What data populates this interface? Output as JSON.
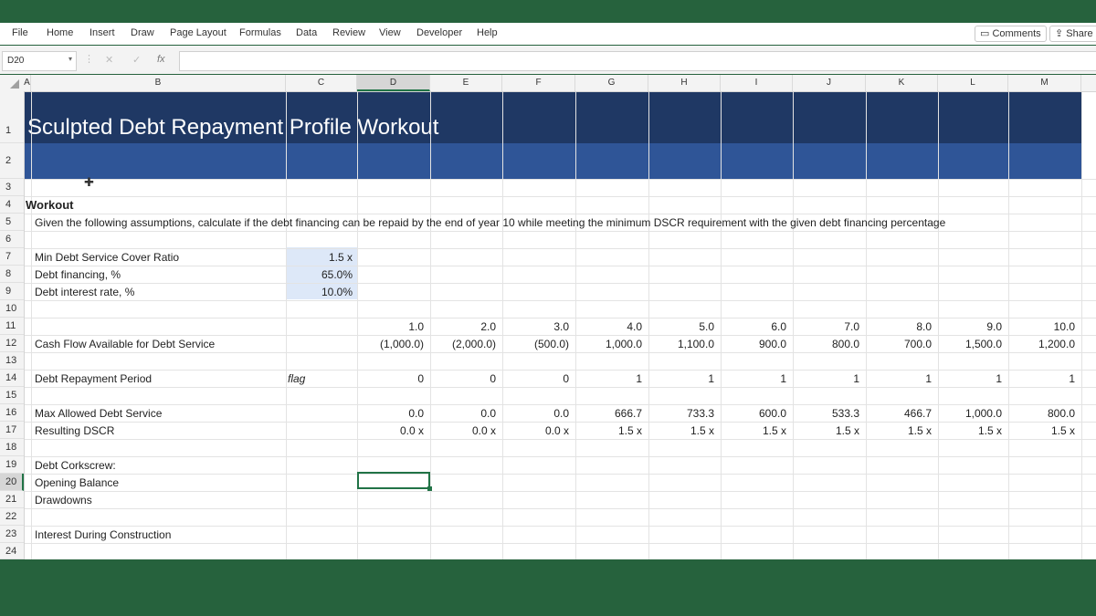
{
  "menu": {
    "items": [
      "File",
      "Home",
      "Insert",
      "Draw",
      "Page Layout",
      "Formulas",
      "Data",
      "Review",
      "View",
      "Developer",
      "Help"
    ],
    "comments": "Comments",
    "share": "Share"
  },
  "formula_bar": {
    "name_box": "D20",
    "fx": "fx",
    "formula": ""
  },
  "columns": [
    "A",
    "B",
    "C",
    "D",
    "E",
    "F",
    "G",
    "H",
    "I",
    "J",
    "K",
    "L",
    "M"
  ],
  "selected_column": "D",
  "rows": [
    "1",
    "2",
    "3",
    "4",
    "5",
    "6",
    "7",
    "8",
    "9",
    "10",
    "11",
    "12",
    "13",
    "14",
    "15",
    "16",
    "17",
    "18",
    "19",
    "20",
    "21",
    "22",
    "23",
    "24"
  ],
  "selected_row": "20",
  "sheet": {
    "title": "Sculpted Debt Repayment Profile Workout",
    "section": "Workout",
    "instructions": "Given the following assumptions, calculate if the debt financing can be repaid by the end of year 10 while meeting the minimum DSCR requirement with the given debt financing percentage",
    "assumptions": [
      {
        "label": "Min Debt Service Cover Ratio",
        "value": "1.5 x"
      },
      {
        "label": "Debt financing, %",
        "value": "65.0%"
      },
      {
        "label": "Debt interest rate, %",
        "value": "10.0%"
      }
    ],
    "years": [
      "1.0",
      "2.0",
      "3.0",
      "4.0",
      "5.0",
      "6.0",
      "7.0",
      "8.0",
      "9.0",
      "10.0"
    ],
    "cfads": {
      "label": "Cash Flow Available for Debt Service",
      "values": [
        "(1,000.0)",
        "(2,000.0)",
        "(500.0)",
        "1,000.0",
        "1,100.0",
        "900.0",
        "800.0",
        "700.0",
        "1,500.0",
        "1,200.0"
      ]
    },
    "repayment": {
      "label": "Debt Repayment Period",
      "flag": "flag",
      "values": [
        "0",
        "0",
        "0",
        "1",
        "1",
        "1",
        "1",
        "1",
        "1",
        "1"
      ]
    },
    "max_ds": {
      "label": "Max Allowed Debt Service",
      "values": [
        "0.0",
        "0.0",
        "0.0",
        "666.7",
        "733.3",
        "600.0",
        "533.3",
        "466.7",
        "1,000.0",
        "800.0"
      ]
    },
    "dscr": {
      "label": "Resulting DSCR",
      "values": [
        "0.0 x",
        "0.0 x",
        "0.0 x",
        "1.5 x",
        "1.5 x",
        "1.5 x",
        "1.5 x",
        "1.5 x",
        "1.5 x",
        "1.5 x"
      ]
    },
    "corkscrew": "Debt Corkscrew:",
    "opening": "Opening Balance",
    "drawdowns": "Drawdowns",
    "idc": "Interest During Construction"
  }
}
